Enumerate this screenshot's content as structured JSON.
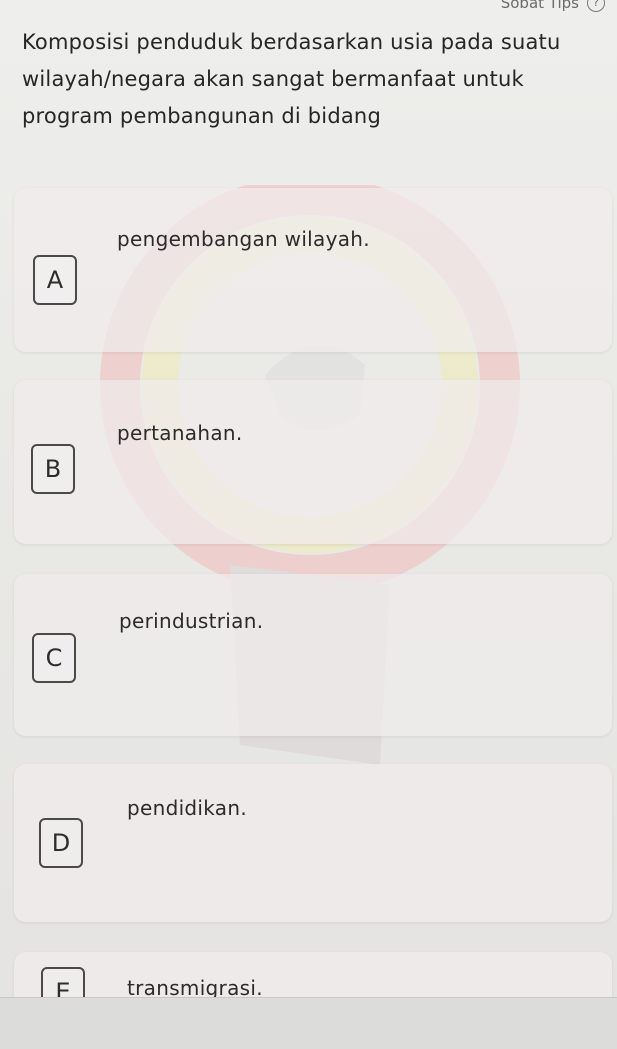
{
  "topbar": {
    "label": "Sobat Tips",
    "help_icon": "help-icon"
  },
  "question": {
    "text": "Komposisi penduduk berdasarkan usia pada suatu wilayah/negara akan sangat bermanfaat untuk program pembangunan di bidang"
  },
  "options": [
    {
      "letter": "A",
      "text": "pengembangan wilayah."
    },
    {
      "letter": "B",
      "text": "pertanahan."
    },
    {
      "letter": "C",
      "text": "perindustrian."
    },
    {
      "letter": "D",
      "text": "pendidikan."
    },
    {
      "letter": "E",
      "text": "transmigrasi."
    }
  ]
}
